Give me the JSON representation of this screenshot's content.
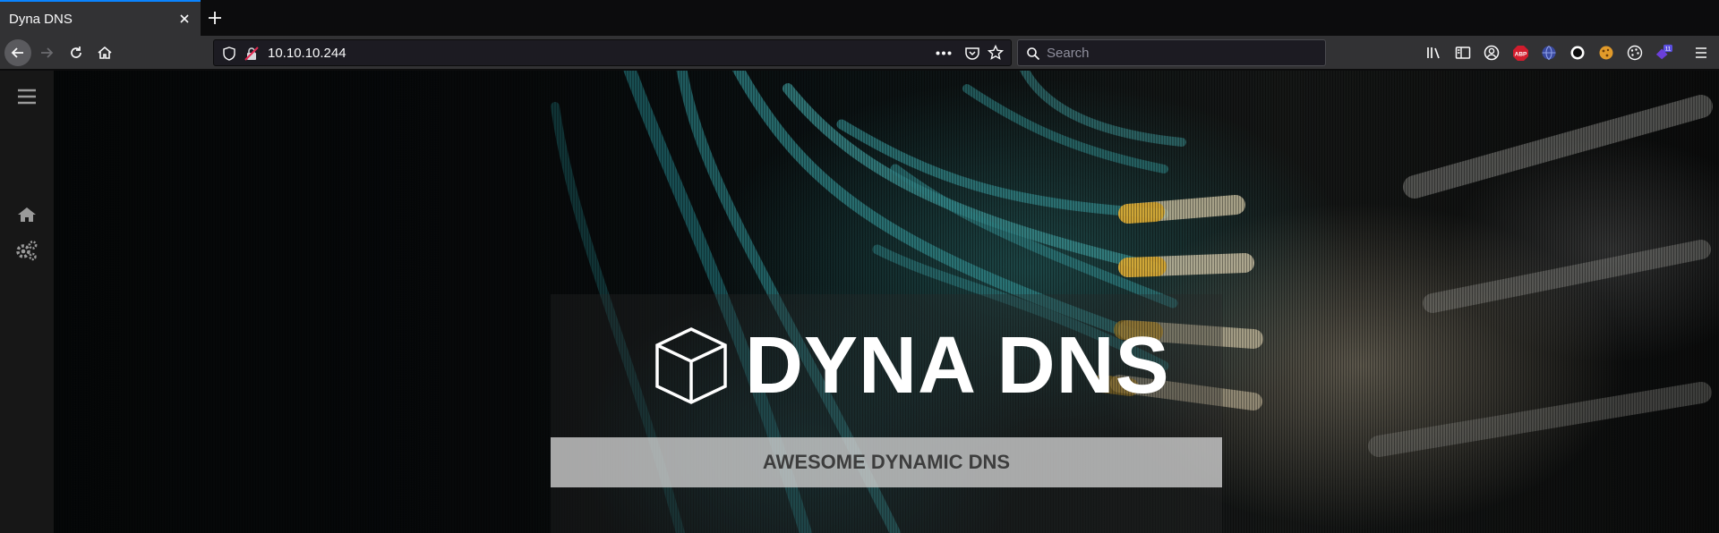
{
  "browser": {
    "tab": {
      "title": "Dyna DNS"
    },
    "url": "10.10.10.244",
    "search_placeholder": "Search",
    "extension_badge": "11",
    "abp_label": "ABP"
  },
  "colors": {
    "accent": "#0a84ff",
    "chrome": "#323234",
    "urlbar": "#1c1b22",
    "sidebar": "#171717"
  },
  "sidebar": {
    "icons": [
      "menu-icon",
      "home-icon",
      "settings-icon"
    ]
  },
  "hero": {
    "brand_title": "DYNA DNS",
    "subtitle": "AWESOME DYNAMIC DNS",
    "logo_icon": "cube-icon"
  }
}
